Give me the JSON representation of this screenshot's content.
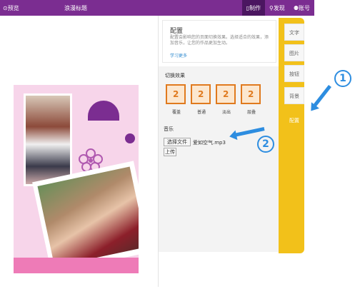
{
  "topbar": {
    "preview": "⊙预览",
    "title": "浪漫标题",
    "tabs": [
      {
        "label": "▯制作",
        "active": true
      },
      {
        "label": "⚲发现",
        "active": false
      },
      {
        "label": "⚉账号",
        "active": false
      }
    ]
  },
  "config": {
    "title": "配置",
    "description": "配置会影响您的页面切换效果。选择适合的效果，添加音乐，让您的作品更加生动。",
    "link": "学习更多"
  },
  "switch_section": {
    "label": "切换效果",
    "effects": [
      {
        "label": "覆盖"
      },
      {
        "label": "普通"
      },
      {
        "label": "淡出"
      },
      {
        "label": "层叠"
      }
    ]
  },
  "music_section": {
    "label": "音乐",
    "file_button": "选择文件",
    "file_name": "爱如空气.mp3",
    "upload_button": "上传"
  },
  "side_tabs": [
    {
      "label": "文字",
      "active": false
    },
    {
      "label": "图片",
      "active": false
    },
    {
      "label": "按钮",
      "active": false
    },
    {
      "label": "背景",
      "active": false
    },
    {
      "label": "配置",
      "active": true
    }
  ],
  "annotations": {
    "one": "1",
    "two": "2"
  },
  "colors": {
    "brand": "#7b2d91",
    "accent": "#f2c11a",
    "effect_orange": "#e07a1e",
    "annotation_blue": "#2d8de0"
  }
}
